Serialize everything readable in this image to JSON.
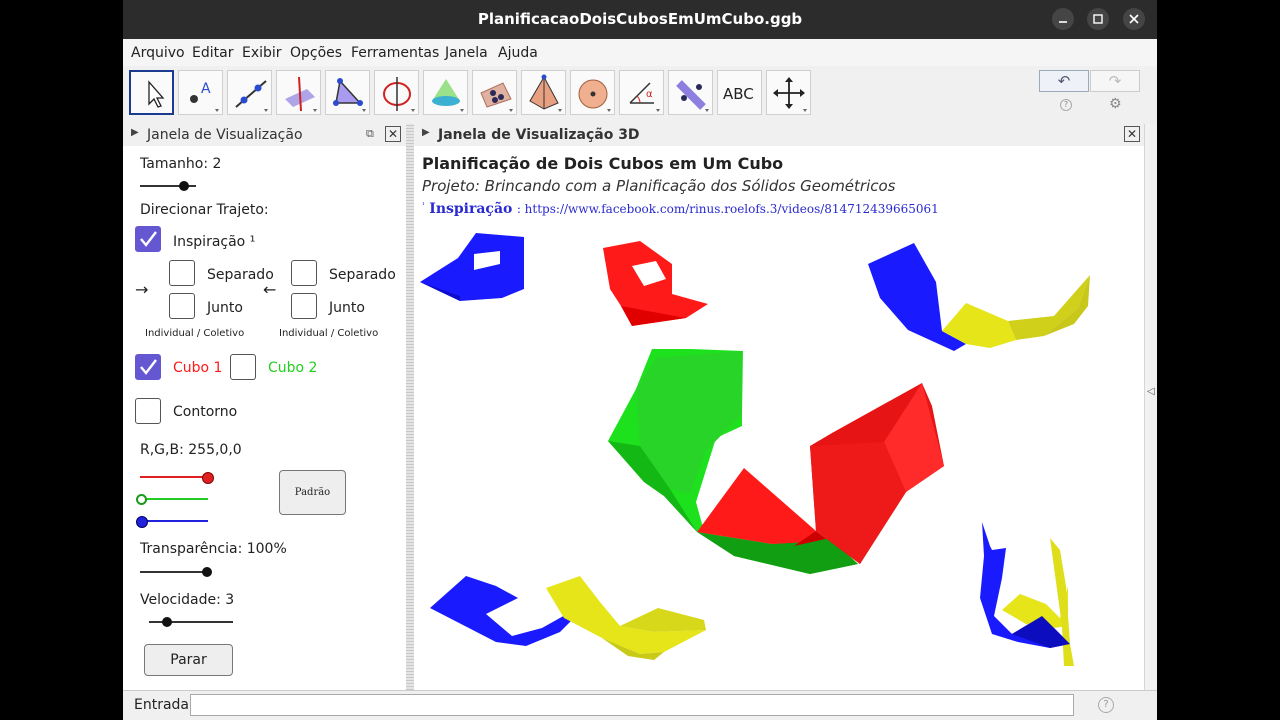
{
  "window": {
    "title": "PlanificacaoDoisCubosEmUmCubo.ggb"
  },
  "menu": [
    "Arquivo",
    "Editar",
    "Exibir",
    "Opções",
    "Ferramentas",
    "Janela",
    "Ajuda"
  ],
  "toolbar": {
    "tools": [
      "move",
      "point",
      "line",
      "perpendicular-line",
      "polygon",
      "circle-axis",
      "cone",
      "plane",
      "pyramid",
      "sphere",
      "angle",
      "reflect",
      "text",
      "move-view"
    ],
    "text_tool_label": "ABC",
    "undo_glyph": "↶",
    "redo_glyph": "↷",
    "help_glyph": "?",
    "settings_glyph": "⚙"
  },
  "left_panel": {
    "header": "Janela de Visualização",
    "tamanho_label": "Tamanho: 2",
    "tamanho_value": 2,
    "direcionar_label": "Direcionar Trajeto:",
    "inspiracao_label": "Inspiração ¹",
    "separado_label": "Separado",
    "junto_label": "Junto",
    "individual_coletivo": "Individual / Coletivo",
    "arrow_right": "→",
    "arrow_left": "←",
    "cubo1_label": "Cubo 1",
    "cubo2_label": "Cubo 2",
    "contorno_label": "Contorno",
    "rgb_label": "R,G,B: 255,0,0",
    "rgb": [
      255,
      0,
      0
    ],
    "padrao_label": "Padrão",
    "transparencia_label": "Transparência: 100%",
    "transparencia_value": 100,
    "velocidade_label": "Velocidade: 3",
    "velocidade_value": 3,
    "parar_label": "Parar",
    "checked": {
      "inspiracao": true,
      "cubo1": true,
      "cubo2": false,
      "contorno": false
    }
  },
  "view3d": {
    "header": "Janela de Visualização 3D",
    "title": "Planificação de Dois Cubos em Um Cubo",
    "subtitle": "Projeto: Brincando com a Planificação dos Sólidos Geométricos",
    "inspiracao_label": "Inspiração",
    "inspiracao_sup": "¹",
    "url": ": https://www.facebook.com/rinus.roelofs.3/videos/814712439665061",
    "colors": {
      "red": "#ff1a1a",
      "green": "#1ee11e",
      "blue": "#1a1aff",
      "yellow": "#f0f01a"
    }
  },
  "input_bar": {
    "label": "Entrada:",
    "placeholder": "",
    "help_glyph": "?"
  },
  "colors": {
    "titlebar": "#2c2c2c",
    "accent": "#6557d2",
    "selected_tool_border": "#1a3b8f"
  }
}
